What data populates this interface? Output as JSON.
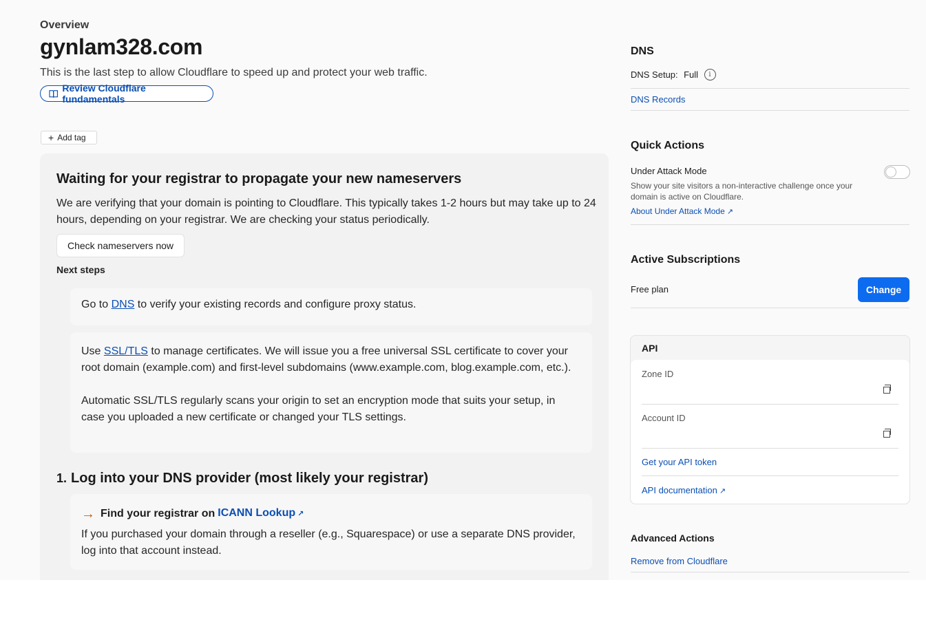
{
  "header": {
    "breadcrumb": "Overview",
    "domain": "gynlam328.com",
    "subtitle": "This is the last step to allow Cloudflare to speed up and protect your web traffic.",
    "review_button": "Review Cloudflare fundamentals",
    "add_tag": "Add tag"
  },
  "status_card": {
    "title": "Waiting for your registrar to propagate your new nameservers",
    "description": "We are verifying that your domain is pointing to Cloudflare. This typically takes 1-2 hours but may take up to 24 hours, depending on your registrar. We are checking your status periodically.",
    "check_button": "Check nameservers now",
    "next_steps_label": "Next steps",
    "dns_step": {
      "prefix": "Go to ",
      "link": "DNS",
      "suffix": " to verify your existing records and configure proxy status."
    },
    "ssl_step": {
      "prefix": "Use ",
      "link": "SSL/TLS",
      "suffix": " to manage certificates. We will issue you a free universal SSL certificate to cover your root domain (example.com) and first-level subdomains (www.example.com, blog.example.com, etc.).",
      "paragraph2": "Automatic SSL/TLS regularly scans your origin to set an encryption mode that suits your setup, in case you uploaded a new certificate or changed your TLS settings."
    },
    "step1": {
      "number": "1.",
      "title": "Log into your DNS provider (most likely your registrar)",
      "find_prefix": "Find your registrar on ",
      "find_link": "ICANN Lookup",
      "body": "If you purchased your domain through a reseller (e.g., Squarespace) or use a separate DNS provider, log into that account instead."
    }
  },
  "sidebar": {
    "dns": {
      "title": "DNS",
      "setup_label": "DNS Setup:",
      "setup_value": "Full",
      "records_link": "DNS Records"
    },
    "quick_actions": {
      "title": "Quick Actions",
      "uam_label": "Under Attack Mode",
      "uam_desc": "Show your site visitors a non-interactive challenge once your domain is active on Cloudflare.",
      "uam_link": "About Under Attack Mode",
      "uam_enabled": false
    },
    "subscriptions": {
      "title": "Active Subscriptions",
      "plan": "Free plan",
      "change_button": "Change"
    },
    "api": {
      "title": "API",
      "zone_id_label": "Zone ID",
      "account_id_label": "Account ID",
      "token_link": "Get your API token",
      "docs_link": "API documentation"
    },
    "advanced": {
      "title": "Advanced Actions",
      "remove_link": "Remove from Cloudflare"
    }
  },
  "colors": {
    "accent": "#0b4fb3",
    "primary_button": "#0d6bf0",
    "arrow": "#c2620a",
    "background": "#fafafa"
  },
  "icons": [
    "book-icon",
    "plus-icon",
    "info-icon",
    "external-link-icon",
    "copy-icon",
    "arrow-right-icon"
  ]
}
